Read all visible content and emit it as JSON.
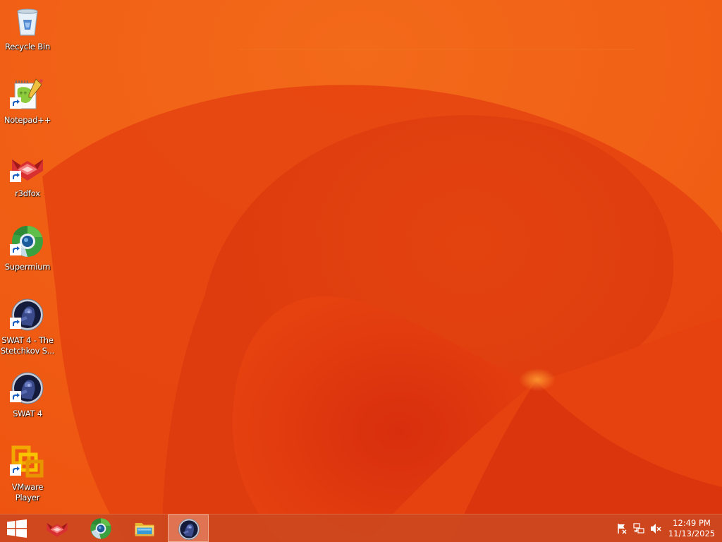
{
  "desktop": {
    "wallpaper": {
      "name": "orange-swirl-wallpaper",
      "colors": {
        "base": "#f05a10",
        "light": "#f36a1a",
        "dark": "#d8300f"
      }
    },
    "icons": [
      {
        "label": "Recycle Bin",
        "icon": "recycle-bin-icon",
        "shortcut": false
      },
      {
        "label": "Notepad++",
        "icon": "notepad-plus-plus-icon",
        "shortcut": true
      },
      {
        "label": "r3dfox",
        "icon": "r3dfox-icon",
        "shortcut": true
      },
      {
        "label": "Supermium",
        "icon": "supermium-icon",
        "shortcut": true
      },
      {
        "label": "SWAT 4 - The Stetchkov S...",
        "icon": "swat4-icon",
        "shortcut": true
      },
      {
        "label": "SWAT 4",
        "icon": "swat4-icon",
        "shortcut": true
      },
      {
        "label": "VMware Player",
        "icon": "vmware-player-icon",
        "shortcut": true
      }
    ]
  },
  "taskbar": {
    "start_icon": "windows-logo-icon",
    "pinned": [
      {
        "icon": "r3dfox-icon",
        "active": false
      },
      {
        "icon": "supermium-icon",
        "active": false
      },
      {
        "icon": "file-explorer-icon",
        "active": false
      },
      {
        "icon": "swat4-icon",
        "active": true
      }
    ],
    "tray": {
      "icons": [
        "action-center-flag-icon",
        "network-icon",
        "volume-muted-icon"
      ],
      "time": "12:49 PM",
      "date": "11/13/2025"
    }
  }
}
